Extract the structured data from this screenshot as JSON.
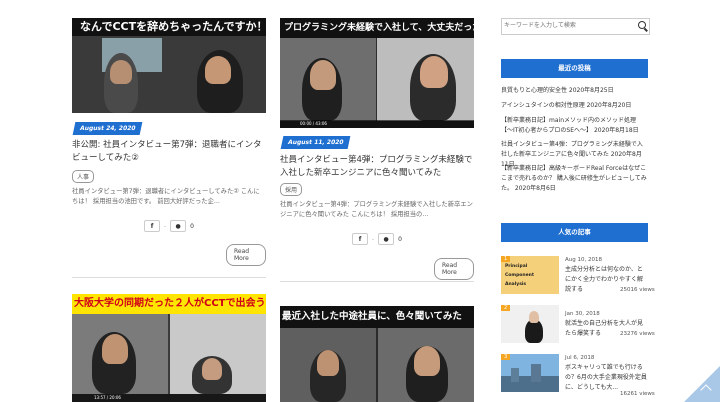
{
  "articles": [
    {
      "banner": "なんでCCTを辞めちゃったんですか！？",
      "date": "August 24, 2020",
      "title": "非公開: 社員インタビュー第7弾：退職者にインタビューしてみた②",
      "tag": "人事",
      "excerpt": "社員インタビュー第7弾：退職者にインタビューしてみた② こんにちは！ 採用担当の池田です。 前回大好評だった企...",
      "fb": "f",
      "share_count": "0",
      "read_more": "Read More"
    },
    {
      "banner": "プログラミング未経験で入社して、大丈夫だった？",
      "date": "August 11, 2020",
      "title": "社員インタビュー第4弾：プログラミング未経験で入社した新卒エンジニアに色々聞いてみた",
      "tag": "採用",
      "excerpt": "社員インタビュー第4弾：プログラミング未経験で入社した新卒エンジニアに色々聞いてみた こんにちは！ 採用担当の...",
      "fb": "f",
      "share_count": "0",
      "read_more": "Read More",
      "video_time": "00:00 / 43:06"
    },
    {
      "banner": "大阪大学の同期だった２人がCCTで出会う？",
      "video_time": "13:57 / 20:06"
    },
    {
      "banner": "最近入社した中途社員に、色々聞いてみた"
    }
  ],
  "search": {
    "placeholder": "キーワードを入力して検索"
  },
  "sidebar": {
    "recent_heading": "最近の投稿",
    "recent": [
      "良質もりと心理的安全性 2020年8月25日",
      "アインシュタインの相対性原理 2020年8月20日",
      "【新卒業務日記】mainメソッド内のメソッド処理 【〜IT初心者からプロのSEへ〜】 2020年8月18日",
      "社員インタビュー第4弾：プログラミング未経験で入社した新卒エンジニアに色々聞いてみた 2020年8月11日",
      "【新卒業務日記】高級キーボードReal Forceはなぜここまで売れるのか？ 購入後に研修生がレビューしてみた。 2020年8月6日"
    ],
    "popular_heading": "人気の記事",
    "popular": [
      {
        "rank": "1",
        "date": "Aug 10, 2018",
        "title": "主成分分析とは何なのか、とにかく全力でわかりやすく解説する",
        "views": "25016 views",
        "thumb_text": [
          "Principal",
          "Component",
          "Analysis"
        ]
      },
      {
        "rank": "2",
        "date": "Jan 30, 2018",
        "title": "就活生の自己分析を大人が見たら爆笑する",
        "views": "23276 views"
      },
      {
        "rank": "3",
        "date": "Jul 6, 2018",
        "title": "ボスキャリって誰でも行けるの？6月の大手企業現役外定員に、どうしても大...",
        "views": "16261 views"
      }
    ]
  },
  "colors": {
    "accent": "#1f6fd1",
    "banner_yellow": "#ffe500"
  }
}
